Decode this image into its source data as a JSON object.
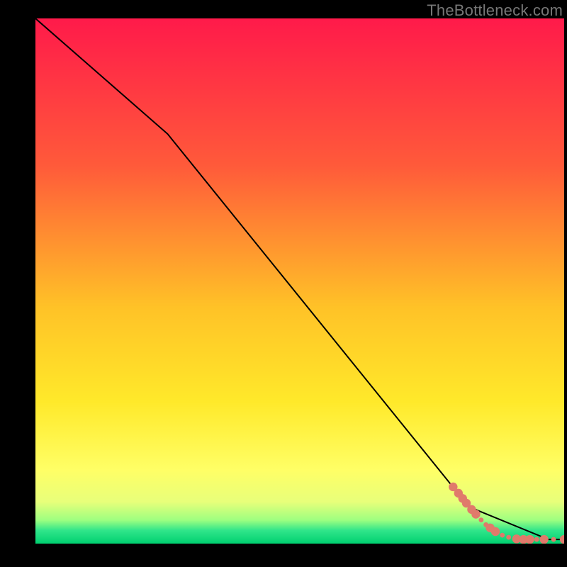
{
  "meta": {
    "watermark": "TheBottleneck.com"
  },
  "chart_data": {
    "type": "line",
    "title": "",
    "xlabel": "",
    "ylabel": "",
    "xlim": [
      0,
      100
    ],
    "ylim": [
      0,
      100
    ],
    "grid": false,
    "background_gradient_stops": [
      {
        "offset": 0.0,
        "color": "#ff1a4a"
      },
      {
        "offset": 0.28,
        "color": "#ff5a3a"
      },
      {
        "offset": 0.55,
        "color": "#ffc227"
      },
      {
        "offset": 0.73,
        "color": "#ffe92a"
      },
      {
        "offset": 0.86,
        "color": "#ffff66"
      },
      {
        "offset": 0.92,
        "color": "#e8ff7a"
      },
      {
        "offset": 0.955,
        "color": "#9eff80"
      },
      {
        "offset": 0.975,
        "color": "#30e58a"
      },
      {
        "offset": 1.0,
        "color": "#00d070"
      }
    ],
    "series": [
      {
        "name": "bottleneck-curve",
        "color": "#000000",
        "stroke_width": 2,
        "x": [
          0,
          25,
          82,
          97,
          100
        ],
        "y": [
          100,
          78,
          7,
          0.8,
          0.8
        ]
      }
    ],
    "markers": {
      "name": "highlight-points",
      "shape": "circle",
      "color": "#e07a6b",
      "radius_large": 6.2,
      "radius_small": 3.4,
      "points": [
        {
          "x": 79.0,
          "y": 10.8,
          "r": "large"
        },
        {
          "x": 80.0,
          "y": 9.6,
          "r": "large"
        },
        {
          "x": 80.8,
          "y": 8.6,
          "r": "large"
        },
        {
          "x": 81.5,
          "y": 7.7,
          "r": "large"
        },
        {
          "x": 82.5,
          "y": 6.5,
          "r": "large"
        },
        {
          "x": 83.3,
          "y": 5.6,
          "r": "large"
        },
        {
          "x": 84.3,
          "y": 4.5,
          "r": "small"
        },
        {
          "x": 85.2,
          "y": 3.6,
          "r": "small"
        },
        {
          "x": 86.0,
          "y": 3.0,
          "r": "large"
        },
        {
          "x": 87.0,
          "y": 2.3,
          "r": "large"
        },
        {
          "x": 88.3,
          "y": 1.6,
          "r": "small"
        },
        {
          "x": 89.5,
          "y": 1.2,
          "r": "small"
        },
        {
          "x": 91.0,
          "y": 0.9,
          "r": "large"
        },
        {
          "x": 92.3,
          "y": 0.8,
          "r": "large"
        },
        {
          "x": 93.5,
          "y": 0.8,
          "r": "large"
        },
        {
          "x": 94.8,
          "y": 0.8,
          "r": "small"
        },
        {
          "x": 96.2,
          "y": 0.8,
          "r": "large"
        },
        {
          "x": 98.0,
          "y": 0.8,
          "r": "small"
        },
        {
          "x": 100.0,
          "y": 0.8,
          "r": "large"
        }
      ]
    }
  }
}
